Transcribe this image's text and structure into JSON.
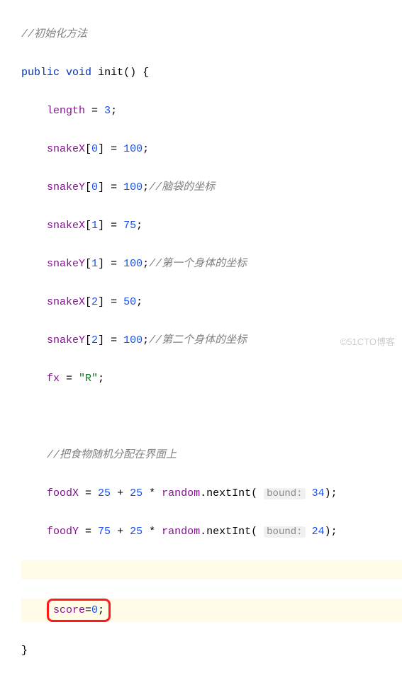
{
  "comments": {
    "c0": "//初始化方法",
    "c1": "//脑袋的坐标",
    "c2": "//第一个身体的坐标",
    "c3": "//第二个身体的坐标",
    "c4": "//把食物随机分配在界面上"
  },
  "code": {
    "kw_public": "public",
    "kw_void": "void",
    "method": "init",
    "brace_open": "{",
    "brace_close": "}",
    "length": "length",
    "snakeX": "snakeX",
    "snakeY": "snakeY",
    "fx": "fx",
    "foodX": "foodX",
    "foodY": "foodY",
    "random": "random",
    "nextInt": ".nextInt",
    "score": "score",
    "eq": " = ",
    "eq_tight": "=",
    "plus": " + ",
    "star": " * ",
    "semi": ";",
    "lbr": "[",
    "rbr": "]",
    "lp": "(",
    "rp": ")",
    "lpn": "( ",
    "str_R": "\"R\""
  },
  "nums": {
    "n3": "3",
    "n100": "100",
    "n75": "75",
    "n50": "50",
    "n25": "25",
    "n34": "34",
    "n24": "24",
    "n0": "0",
    "i0": "0",
    "i1": "1",
    "i2": "2"
  },
  "hints": {
    "bound": "bound:"
  },
  "watermark": "©51CTO博客"
}
